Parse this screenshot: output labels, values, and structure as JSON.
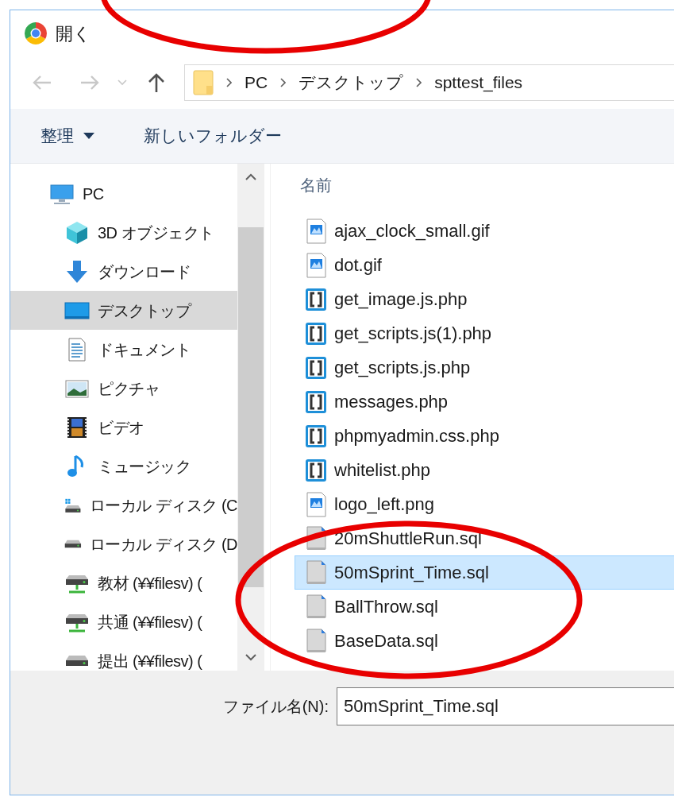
{
  "window": {
    "title": "開く"
  },
  "nav_buttons": [
    {
      "kind": "back",
      "disabled": true
    },
    {
      "kind": "forward",
      "disabled": true
    },
    {
      "kind": "recent",
      "disabled": true
    },
    {
      "kind": "up",
      "disabled": false
    }
  ],
  "address_bar": {
    "segments": [
      "PC",
      "デスクトップ",
      "spttest_files"
    ]
  },
  "toolbar": [
    {
      "label": "整理",
      "kind": "menu"
    },
    {
      "label": "新しいフォルダー",
      "kind": "plain"
    }
  ],
  "sidebar": {
    "items": [
      {
        "label": "PC",
        "kind": "pc",
        "selected": false,
        "children": [
          {
            "label": "3D オブジェクト",
            "kind": "cube",
            "selected": false
          },
          {
            "label": "ダウンロード",
            "kind": "download",
            "selected": false
          },
          {
            "label": "デスクトップ",
            "kind": "desktop",
            "selected": true
          },
          {
            "label": "ドキュメント",
            "kind": "document",
            "selected": false
          },
          {
            "label": "ピクチャ",
            "kind": "picture",
            "selected": false
          },
          {
            "label": "ビデオ",
            "kind": "video",
            "selected": false
          },
          {
            "label": "ミュージック",
            "kind": "music",
            "selected": false
          },
          {
            "label": "ローカル ディスク (C",
            "kind": "system-drive",
            "selected": false
          },
          {
            "label": "ローカル ディスク (D",
            "kind": "drive",
            "selected": false
          },
          {
            "label": "教材 (¥¥filesv) (",
            "kind": "network-drive",
            "selected": false
          },
          {
            "label": "共通 (¥¥filesv) (",
            "kind": "network-drive",
            "selected": false
          },
          {
            "label": "提出 (¥¥filesv) (",
            "kind": "drive",
            "selected": false
          }
        ]
      }
    ]
  },
  "file_list": {
    "columns": [
      "名前"
    ],
    "files": [
      {
        "name": "ajax_clock_small.gif",
        "kind": "image",
        "selected": false
      },
      {
        "name": "dot.gif",
        "kind": "image",
        "selected": false
      },
      {
        "name": "get_image.js.php",
        "kind": "script",
        "selected": false
      },
      {
        "name": "get_scripts.js(1).php",
        "kind": "script",
        "selected": false
      },
      {
        "name": "get_scripts.js.php",
        "kind": "script",
        "selected": false
      },
      {
        "name": "messages.php",
        "kind": "script",
        "selected": false
      },
      {
        "name": "phpmyadmin.css.php",
        "kind": "script",
        "selected": false
      },
      {
        "name": "whitelist.php",
        "kind": "script",
        "selected": false
      },
      {
        "name": "logo_left.png",
        "kind": "image",
        "selected": false
      },
      {
        "name": "20mShuttleRun.sql",
        "kind": "sql",
        "selected": false
      },
      {
        "name": "50mSprint_Time.sql",
        "kind": "sql",
        "selected": true
      },
      {
        "name": "BallThrow.sql",
        "kind": "sql",
        "selected": false
      },
      {
        "name": "BaseData.sql",
        "kind": "sql",
        "selected": false
      }
    ]
  },
  "file_name": {
    "label": "ファイル名(N):",
    "value": "50mSprint_Time.sql"
  }
}
